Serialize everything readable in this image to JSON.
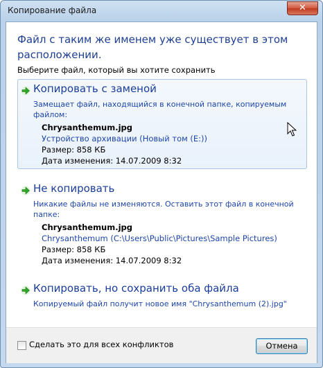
{
  "window": {
    "title": "Копирование файла",
    "close_label": "✕"
  },
  "dialog": {
    "heading": "Файл с таким же именем уже существует в этом расположении.",
    "subheading": "Выберите файл, который вы хотите сохранить"
  },
  "options": [
    {
      "title": "Копировать с заменой",
      "description": "Замещает файл, находящийся в конечной папке, копируемым файлом:",
      "file_name": "Chrysanthemum.jpg",
      "location": "Устройство архивации (Новый том (E:))",
      "size": "Размер: 858 КБ",
      "modified": "Дата изменения: 14.07.2009 8:32"
    },
    {
      "title": "Не копировать",
      "description": "Никакие файлы не изменяются. Оставить этот файл в конечной папке:",
      "file_name": "Chrysanthemum.jpg",
      "location": "Chrysanthemum (C:\\Users\\Public\\Pictures\\Sample Pictures)",
      "size": "Размер: 858 КБ",
      "modified": "Дата изменения: 14.07.2009 8:32"
    },
    {
      "title": "Копировать, но сохранить оба файла",
      "description": "Копируемый файл получит новое имя \"Chrysanthemum (2).jpg\""
    }
  ],
  "footer": {
    "checkbox_label": "Сделать это для всех конфликтов",
    "checkbox_checked": false,
    "cancel_label": "Отмена"
  },
  "colors": {
    "link_blue": "#1d46a9",
    "arrow_green": "#2fa52a"
  }
}
